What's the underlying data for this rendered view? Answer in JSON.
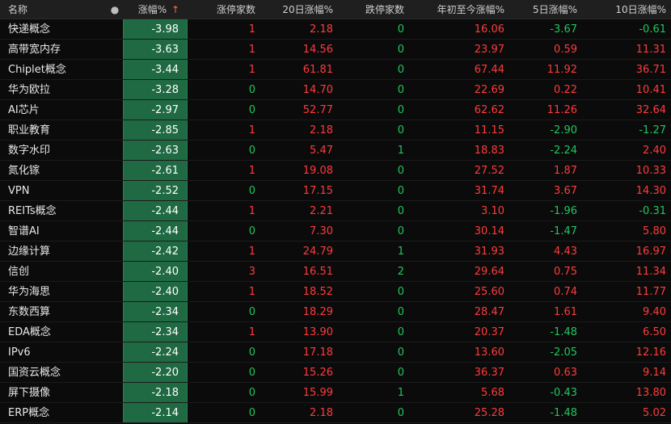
{
  "header": {
    "name": "名称",
    "dot": "●",
    "chg": "涨幅%",
    "chg_sort": "↑",
    "limit_up": "涨停家数",
    "ret20": "20日涨幅%",
    "limit_down": "跌停家数",
    "ytd": "年初至今涨幅%",
    "ret5": "5日涨幅%",
    "ret10": "10日涨幅%"
  },
  "rows": [
    {
      "name": "快递概念",
      "chg": "-3.98",
      "limit_up": "1",
      "ret20": "2.18",
      "limit_down": "0",
      "ytd": "16.06",
      "ret5": "-3.67",
      "ret10": "-0.61"
    },
    {
      "name": "高带宽内存",
      "chg": "-3.63",
      "limit_up": "1",
      "ret20": "14.56",
      "limit_down": "0",
      "ytd": "23.97",
      "ret5": "0.59",
      "ret10": "11.31"
    },
    {
      "name": "Chiplet概念",
      "chg": "-3.44",
      "limit_up": "1",
      "ret20": "61.81",
      "limit_down": "0",
      "ytd": "67.44",
      "ret5": "11.92",
      "ret10": "36.71"
    },
    {
      "name": "华为欧拉",
      "chg": "-3.28",
      "limit_up": "0",
      "ret20": "14.70",
      "limit_down": "0",
      "ytd": "22.69",
      "ret5": "0.22",
      "ret10": "10.41"
    },
    {
      "name": "AI芯片",
      "chg": "-2.97",
      "limit_up": "0",
      "ret20": "52.77",
      "limit_down": "0",
      "ytd": "62.62",
      "ret5": "11.26",
      "ret10": "32.64"
    },
    {
      "name": "职业教育",
      "chg": "-2.85",
      "limit_up": "1",
      "ret20": "2.18",
      "limit_down": "0",
      "ytd": "11.15",
      "ret5": "-2.90",
      "ret10": "-1.27"
    },
    {
      "name": "数字水印",
      "chg": "-2.63",
      "limit_up": "0",
      "ret20": "5.47",
      "limit_down": "1",
      "ytd": "18.83",
      "ret5": "-2.24",
      "ret10": "2.40"
    },
    {
      "name": "氮化镓",
      "chg": "-2.61",
      "limit_up": "1",
      "ret20": "19.08",
      "limit_down": "0",
      "ytd": "27.52",
      "ret5": "1.87",
      "ret10": "10.33"
    },
    {
      "name": "VPN",
      "chg": "-2.52",
      "limit_up": "0",
      "ret20": "17.15",
      "limit_down": "0",
      "ytd": "31.74",
      "ret5": "3.67",
      "ret10": "14.30"
    },
    {
      "name": "REITs概念",
      "chg": "-2.44",
      "limit_up": "1",
      "ret20": "2.21",
      "limit_down": "0",
      "ytd": "3.10",
      "ret5": "-1.96",
      "ret10": "-0.31"
    },
    {
      "name": "智谱AI",
      "chg": "-2.44",
      "limit_up": "0",
      "ret20": "7.30",
      "limit_down": "0",
      "ytd": "30.14",
      "ret5": "-1.47",
      "ret10": "5.80"
    },
    {
      "name": "边缘计算",
      "chg": "-2.42",
      "limit_up": "1",
      "ret20": "24.79",
      "limit_down": "1",
      "ytd": "31.93",
      "ret5": "4.43",
      "ret10": "16.97"
    },
    {
      "name": "信创",
      "chg": "-2.40",
      "limit_up": "3",
      "ret20": "16.51",
      "limit_down": "2",
      "ytd": "29.64",
      "ret5": "0.75",
      "ret10": "11.34"
    },
    {
      "name": "华为海思",
      "chg": "-2.40",
      "limit_up": "1",
      "ret20": "18.52",
      "limit_down": "0",
      "ytd": "25.60",
      "ret5": "0.74",
      "ret10": "11.77"
    },
    {
      "name": "东数西算",
      "chg": "-2.34",
      "limit_up": "0",
      "ret20": "18.29",
      "limit_down": "0",
      "ytd": "28.47",
      "ret5": "1.61",
      "ret10": "9.40"
    },
    {
      "name": "EDA概念",
      "chg": "-2.34",
      "limit_up": "1",
      "ret20": "13.90",
      "limit_down": "0",
      "ytd": "20.37",
      "ret5": "-1.48",
      "ret10": "6.50"
    },
    {
      "name": "IPv6",
      "chg": "-2.24",
      "limit_up": "0",
      "ret20": "17.18",
      "limit_down": "0",
      "ytd": "13.60",
      "ret5": "-2.05",
      "ret10": "12.16"
    },
    {
      "name": "国资云概念",
      "chg": "-2.20",
      "limit_up": "0",
      "ret20": "15.26",
      "limit_down": "0",
      "ytd": "36.37",
      "ret5": "0.63",
      "ret10": "9.14"
    },
    {
      "name": "屏下摄像",
      "chg": "-2.18",
      "limit_up": "0",
      "ret20": "15.99",
      "limit_down": "1",
      "ytd": "5.68",
      "ret5": "-0.43",
      "ret10": "13.80"
    },
    {
      "name": "ERP概念",
      "chg": "-2.14",
      "limit_up": "0",
      "ret20": "2.18",
      "limit_down": "0",
      "ytd": "25.28",
      "ret5": "-1.48",
      "ret10": "5.02"
    }
  ],
  "colors": {
    "up": "#ff3b3b",
    "down": "#22c55e",
    "highlight_bg": "#1f6a43",
    "header_bg": "#1f1f1f",
    "page_bg": "#0b0b0b"
  }
}
